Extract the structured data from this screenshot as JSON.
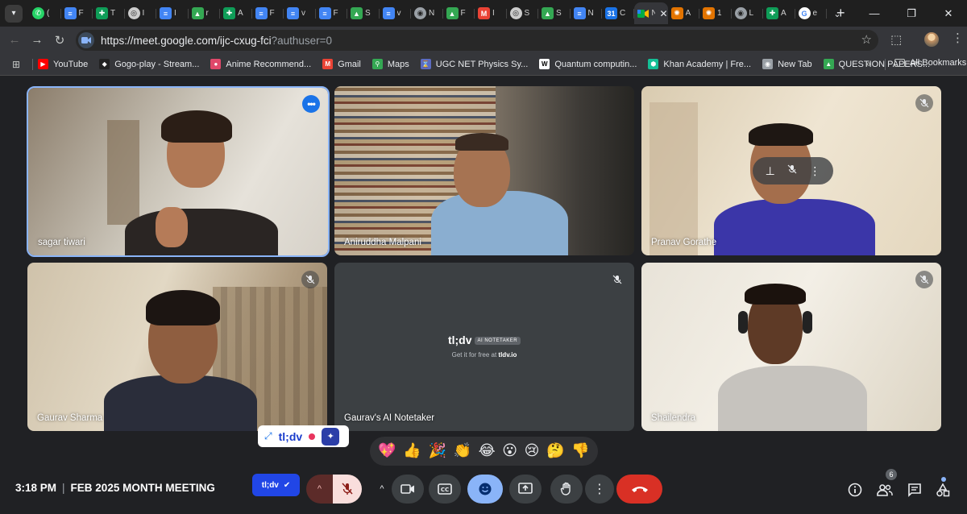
{
  "browser": {
    "tabs": [
      {
        "icon": "whatsapp-icon",
        "color": "#25d366",
        "letter": "(",
        "glyph": "✆"
      },
      {
        "icon": "docs-icon",
        "color": "#4285f4",
        "letter": "F",
        "glyph": "≡"
      },
      {
        "icon": "sheets-icon",
        "color": "#0f9d58",
        "letter": "T",
        "glyph": "✚"
      },
      {
        "icon": "chatgpt-icon",
        "color": "#cccccc",
        "letter": "I",
        "glyph": "◎"
      },
      {
        "icon": "docs-icon",
        "color": "#4285f4",
        "letter": "I",
        "glyph": "≡"
      },
      {
        "icon": "drive-icon",
        "color": "#34a853",
        "letter": "r",
        "glyph": "▲"
      },
      {
        "icon": "sheets-icon",
        "color": "#0f9d58",
        "letter": "A",
        "glyph": "✚"
      },
      {
        "icon": "docs-icon",
        "color": "#4285f4",
        "letter": "F",
        "glyph": "≡"
      },
      {
        "icon": "docs-icon",
        "color": "#4285f4",
        "letter": "v",
        "glyph": "≡"
      },
      {
        "icon": "docs-icon",
        "color": "#4285f4",
        "letter": "F",
        "glyph": "≡"
      },
      {
        "icon": "drive-icon",
        "color": "#34a853",
        "letter": "S",
        "glyph": "▲"
      },
      {
        "icon": "docs-icon",
        "color": "#4285f4",
        "letter": "v",
        "glyph": "≡"
      },
      {
        "icon": "web-icon",
        "color": "#9aa0a6",
        "letter": "N",
        "glyph": "◉"
      },
      {
        "icon": "drive-icon",
        "color": "#34a853",
        "letter": "F",
        "glyph": "▲"
      },
      {
        "icon": "gmail-icon",
        "color": "#ea4335",
        "letter": "I",
        "glyph": "M"
      },
      {
        "icon": "chatgpt-icon",
        "color": "#cccccc",
        "letter": "S",
        "glyph": "◎"
      },
      {
        "icon": "drive-icon",
        "color": "#34a853",
        "letter": "S",
        "glyph": "▲"
      },
      {
        "icon": "docs-icon",
        "color": "#4285f4",
        "letter": "N",
        "glyph": "≡"
      },
      {
        "icon": "calendar-icon",
        "color": "#1a73e8",
        "letter": "C",
        "glyph": "31"
      },
      {
        "icon": "meet-icon",
        "color": "#35363a",
        "letter": "N",
        "glyph": "",
        "active": true
      },
      {
        "icon": "gear-tab-icon",
        "color": "#e37400",
        "letter": "A",
        "glyph": "✺"
      },
      {
        "icon": "gear-tab-icon",
        "color": "#e37400",
        "letter": "1",
        "glyph": "✺"
      },
      {
        "icon": "web-icon",
        "color": "#9aa0a6",
        "letter": "L",
        "glyph": "◉"
      },
      {
        "icon": "sheets-icon",
        "color": "#0f9d58",
        "letter": "A",
        "glyph": "✚"
      },
      {
        "icon": "google-icon",
        "color": "#ffffff",
        "letter": "e",
        "glyph": "G"
      }
    ],
    "url_main": "https://meet.google.com/ijc-cxug-fci",
    "url_query": "?authuser=0",
    "bookmarks": [
      {
        "label": "YouTube",
        "color": "#ff0000",
        "glyph": "▶",
        "icon": "youtube-icon"
      },
      {
        "label": "Gogo-play - Stream...",
        "color": "#222222",
        "glyph": "◆",
        "icon": "gogoplay-icon"
      },
      {
        "label": "Anime Recommend...",
        "color": "#e0486a",
        "glyph": "●",
        "icon": "anime-icon"
      },
      {
        "label": "Gmail",
        "color": "#ea4335",
        "glyph": "M",
        "icon": "gmail-icon"
      },
      {
        "label": "Maps",
        "color": "#34a853",
        "glyph": "⚲",
        "icon": "maps-icon"
      },
      {
        "label": "UGC NET Physics Sy...",
        "color": "#5c6bc0",
        "glyph": "⌛",
        "icon": "ugc-icon"
      },
      {
        "label": "Quantum computin...",
        "color": "#ffffff",
        "glyph": "W",
        "icon": "wikipedia-icon"
      },
      {
        "label": "Khan Academy | Fre...",
        "color": "#14bf96",
        "glyph": "⬢",
        "icon": "khan-icon"
      },
      {
        "label": "New Tab",
        "color": "#9aa0a6",
        "glyph": "◉",
        "icon": "newtab-icon"
      },
      {
        "label": "QUESTION PAPERS...",
        "color": "#34a853",
        "glyph": "▲",
        "icon": "drive-icon"
      }
    ],
    "all_bookmarks": "All Bookmarks"
  },
  "meet": {
    "participants": [
      {
        "name": "sagar tiwari",
        "muted": false,
        "speaking": true
      },
      {
        "name": "Aniruddha Malpani",
        "muted": false
      },
      {
        "name": "Pranav Gorathe",
        "muted": true
      },
      {
        "name": "Gaurav Sharma",
        "muted": true
      },
      {
        "name": "Gaurav's AI Notetaker",
        "muted": true
      },
      {
        "name": "Shailendra",
        "muted": true
      }
    ],
    "notetaker": {
      "brand": "tl;dv",
      "badge": "AI NOTETAKER",
      "sub_prefix": "Get it for free at",
      "sub_link": "tldv.io"
    },
    "widget_label": "tl;dv",
    "reactions": [
      "💖",
      "👍",
      "🎉",
      "👏",
      "😂",
      "😮",
      "😢",
      "🤔",
      "👎"
    ],
    "time": "3:18 PM",
    "meeting_title": "FEB 2025 MONTH MEETING",
    "tldv_pill": "tl;dv",
    "people_count": "6"
  }
}
